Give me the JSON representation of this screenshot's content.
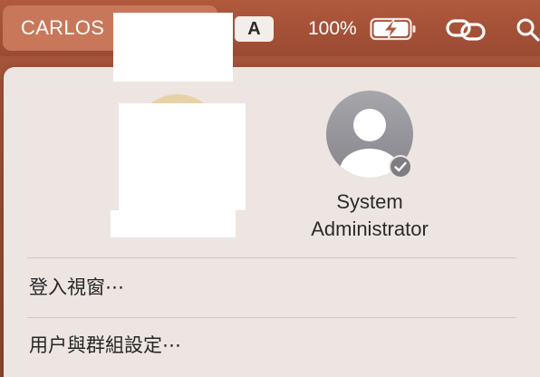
{
  "menubar": {
    "user_name": "CARLOS",
    "input_source_label": "A",
    "battery_percent": "100%",
    "icons": {
      "battery": "battery-charging-icon",
      "link": "link-icon",
      "search": "search-icon"
    }
  },
  "user_menu": {
    "users": [
      {
        "name": "",
        "avatar": "user-avatar-photo"
      },
      {
        "name": "System\nAdministrator",
        "avatar": "default-user-icon",
        "status": "checkmark-badge-icon"
      }
    ],
    "items": [
      {
        "label": "登入視窗⋯"
      },
      {
        "label": "用户與群組設定⋯"
      }
    ]
  },
  "colors": {
    "menubar_bg": "#a8573c",
    "highlight_pill": "#c9775a",
    "panel_bg": "#ece5e2"
  }
}
